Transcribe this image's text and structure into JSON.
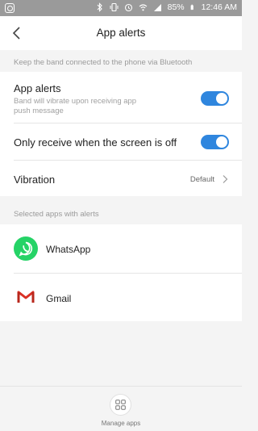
{
  "status_bar": {
    "battery_percent": "85%",
    "time": "12:46 AM",
    "icons": [
      "app-badge-icon",
      "bluetooth-icon",
      "vibrate-icon",
      "alarm-icon",
      "wifi-icon",
      "signal-icon",
      "battery-icon"
    ]
  },
  "header": {
    "title": "App alerts",
    "back_icon": "chevron-left-icon"
  },
  "bluetooth_caption": "Keep the band connected to the phone via Bluetooth",
  "settings": {
    "app_alerts": {
      "title": "App alerts",
      "subtitle": "Band will vibrate upon receiving app push message",
      "enabled": true
    },
    "screen_off": {
      "title": "Only receive when the screen is off",
      "enabled": true
    },
    "vibration": {
      "title": "Vibration",
      "value": "Default"
    }
  },
  "apps_caption": "Selected apps with alerts",
  "apps": [
    {
      "name": "WhatsApp",
      "icon": "whatsapp-icon",
      "color": "#25d366"
    },
    {
      "name": "Gmail",
      "icon": "gmail-icon",
      "color": "#d93025"
    }
  ],
  "bottom": {
    "manage_label": "Manage apps",
    "manage_icon": "grid-icon"
  },
  "colors": {
    "toggle_on": "#2f86de",
    "background": "#f4f4f4",
    "status_bar": "#9a9a9a"
  }
}
